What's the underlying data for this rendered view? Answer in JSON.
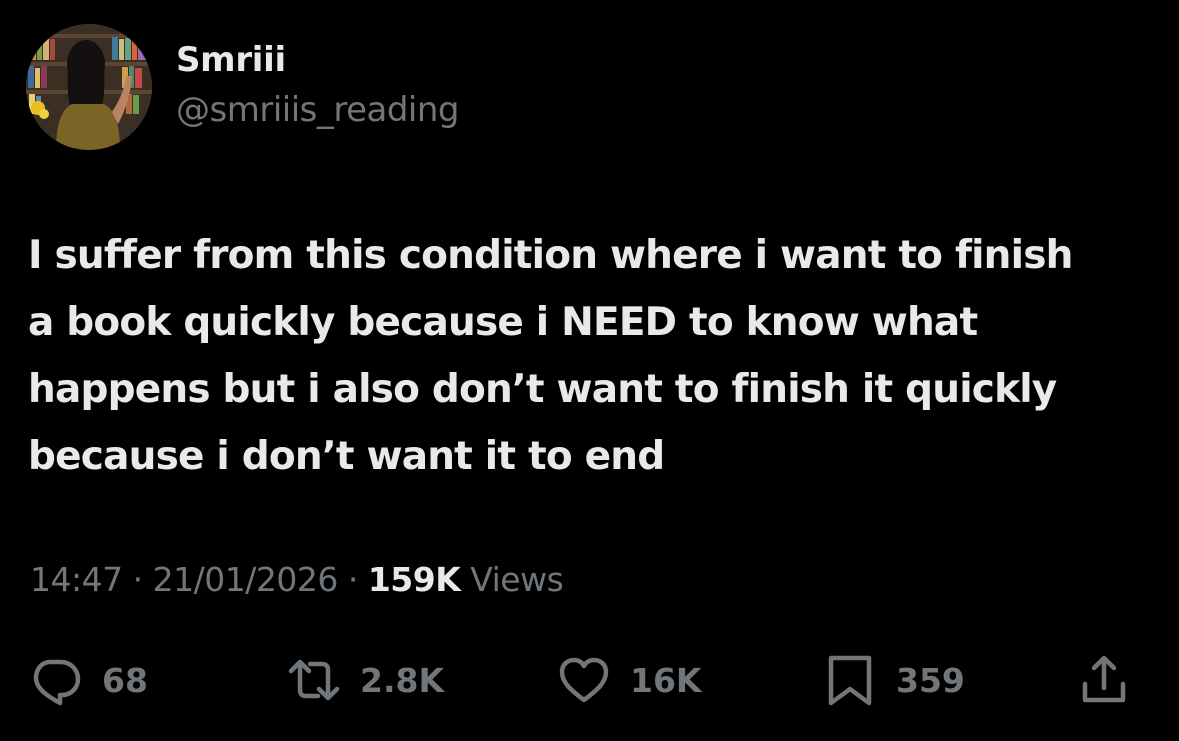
{
  "user": {
    "display_name": "Smriii",
    "handle": "@smriiis_reading",
    "avatar_icon": "profile-photo-bookstore"
  },
  "tweet": {
    "text": "I suffer from this condition where i want to finish\na book quickly because i NEED to know what\nhappens but i also don’t want to finish it quickly\nbecause i don’t want it to end"
  },
  "meta": {
    "time": "14:47",
    "separator": "·",
    "date": "21/01/2026",
    "views_count": "159K",
    "views_label": "Views"
  },
  "actions": {
    "reply": {
      "icon": "reply-icon",
      "count": "68"
    },
    "repost": {
      "icon": "repost-icon",
      "count": "2.8K"
    },
    "like": {
      "icon": "heart-icon",
      "count": "16K"
    },
    "bookmark": {
      "icon": "bookmark-icon",
      "count": "359"
    },
    "share": {
      "icon": "share-icon"
    }
  },
  "colors": {
    "background": "#000000",
    "primary_text": "#e7e9ea",
    "secondary_text": "#71767b"
  }
}
